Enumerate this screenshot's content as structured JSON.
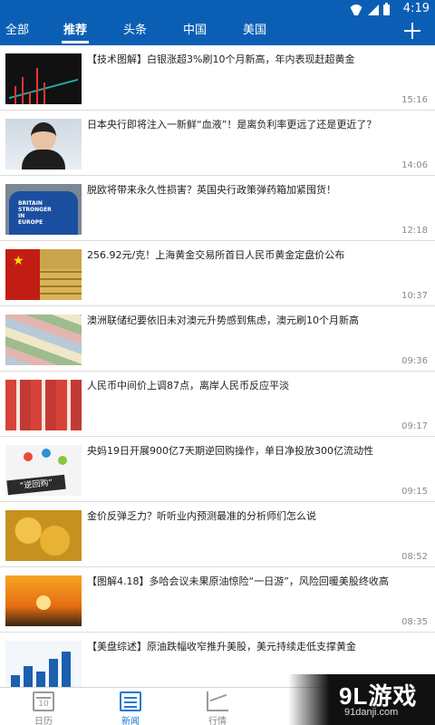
{
  "status_bar": {
    "time": "4:19"
  },
  "tabs": [
    {
      "label": "全部"
    },
    {
      "label": "推荐"
    },
    {
      "label": "头条"
    },
    {
      "label": "中国"
    },
    {
      "label": "美国"
    }
  ],
  "active_tab": "推荐",
  "news": [
    {
      "title": "【技术图解】白银涨超3%刷10个月新高，年内表现赶超黄金",
      "time": "15:16",
      "thumb": "silver-chart"
    },
    {
      "title": "日本央行即将注入一新鲜“血液”！是离负利率更远了还是更近了？",
      "time": "14:06",
      "thumb": "woman-portrait"
    },
    {
      "title": "脱欧将带来永久性损害？英国央行政策弹药箱加紧囤货！",
      "time": "12:18",
      "thumb": "britain-shirt"
    },
    {
      "title": "256.92元/克！上海黄金交易所首日人民币黄金定盘价公布",
      "time": "10:37",
      "thumb": "gold-bars-flag"
    },
    {
      "title": "澳洲联储纪要依旧未对澳元升势感到焦虑，澳元刷10个月新高",
      "time": "09:36",
      "thumb": "banknotes"
    },
    {
      "title": "人民币中间价上调87点，离岸人民币反应平淡",
      "time": "09:17",
      "thumb": "rmb-notes"
    },
    {
      "title": "央妈19日开展900亿7天期逆回购操作，单日净投放300亿流动性",
      "time": "09:15",
      "thumb": "reverse-repo"
    },
    {
      "title": "金价反弹乏力？听听业内预测最准的分析师们怎么说",
      "time": "08:52",
      "thumb": "gold-coins"
    },
    {
      "title": "【图解4.18】多哈会议未果原油惊险“一日游”，风险回暖美股终收高",
      "time": "08:35",
      "thumb": "oil-sunset"
    },
    {
      "title": "【美盘综述】原油跌幅收窄推升美股，美元持续走低支撑黄金",
      "time": "",
      "thumb": "us-market"
    }
  ],
  "bottom_nav": [
    {
      "label": "日历",
      "icon": "calendar-icon",
      "icon_text": "10"
    },
    {
      "label": "新闻",
      "icon": "news-icon"
    },
    {
      "label": "行情",
      "icon": "chart-icon"
    }
  ],
  "active_nav": "新闻",
  "watermark": {
    "logo": "9L游戏",
    "url": "91danji.com"
  },
  "colors": {
    "header": "#0a5fb4",
    "active_nav": "#1d78d0",
    "time": "#8a8a8a"
  }
}
